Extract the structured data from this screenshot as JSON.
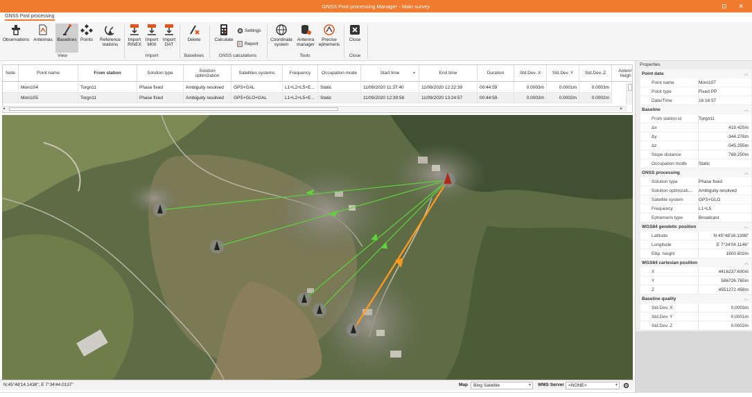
{
  "window": {
    "title": "GNSS Post processing Manager - Main survey",
    "controls": [
      "⊡",
      "✕"
    ]
  },
  "ribbon_tab": "GNSS Post processing",
  "ribbon": {
    "view": {
      "label": "View",
      "buttons": {
        "observations": "Observations",
        "antennas": "Antennas",
        "baselines": "Baselines",
        "points": "Points",
        "reference_l1": "Reference",
        "reference_l2": "stations"
      }
    },
    "import": {
      "label": "Import",
      "buttons": {
        "rinex_l1": "Import",
        "rinex_l2": "RINEX",
        "m00_l1": "Import",
        "m00_l2": "M00",
        "dat_l1": "Import",
        "dat_l2": "DAT"
      }
    },
    "baselines": {
      "label": "Baselines",
      "delete": "Delete"
    },
    "gnss_calc": {
      "label": "GNSS calculations",
      "calculate": "Calculate",
      "settings": "Settings",
      "report": "Report"
    },
    "tools": {
      "label": "Tools",
      "coord_l1": "Coordinate",
      "coord_l2": "system",
      "antenna_l1": "Antenna",
      "antenna_l2": "manager",
      "precise_l1": "Precise",
      "precise_l2": "ephemeris"
    },
    "close": {
      "label": "Close",
      "button": "Close"
    }
  },
  "grid": {
    "headers": {
      "note": "Note",
      "point_name": "Point name",
      "from_station": "From station",
      "solution_type": "Solution type",
      "solution_opt_l1": "Solution",
      "solution_opt_l2": "optimization",
      "satellites": "Satellites systems",
      "frequency": "Frequency",
      "occupation": "Occupation mode",
      "start_time": "Start time",
      "end_time": "End time",
      "duration": "Duration",
      "sdx": "Std.Dev. X",
      "sdy": "Std.Dev. Y",
      "sdz": "Std.Dev. Z",
      "antenna_l1": "Antenn",
      "antenna_l2": "heigh"
    },
    "rows": [
      {
        "point_name": "Moni104",
        "from_station": "Torgn11",
        "solution_type": "Phase fixed",
        "solution_opt": "Ambiguity resolved",
        "satellites": "GPS+GAL",
        "frequency": "L1+L2+L5+E...",
        "occupation": "Static",
        "start_time": "11/09/2020 11:37:40",
        "end_time": "11/09/2020 12:22:39",
        "duration": "00:44:59",
        "sdx": "0.0003m",
        "sdy": "0.0001m",
        "sdz": "0.0003m"
      },
      {
        "point_name": "Moni105",
        "from_station": "Torgn11",
        "solution_type": "Phase fixed",
        "solution_opt": "Ambiguity resolved",
        "satellites": "GPS+GLO+GAL",
        "frequency": "L1+L2+L5+E...",
        "occupation": "Static",
        "start_time": "11/09/2020 12:39:58",
        "end_time": "11/09/2020 13:24:57",
        "duration": "00:44:59",
        "sdx": "0.0003m",
        "sdy": "0.0002m",
        "sdz": "0.0002m"
      }
    ]
  },
  "map": {
    "coords": "N:45°48'14.1438\"; E 7°34'44.0137\"",
    "map_label": "Map",
    "map_value": "Bing Satellite",
    "wms_label": "WMS Server",
    "wms_value": "<NONE>",
    "baseline_colors": {
      "normal": "#5fd43a",
      "selected": "#ff9a1f"
    }
  },
  "properties": {
    "title": "Properties",
    "point_data": {
      "label": "Point data",
      "name_k": "Point name",
      "name_v": "Moni107",
      "type_k": "Point type",
      "type_v": "Fixed PP",
      "dt_k": "Date/Time",
      "dt_v": "16:16:57"
    },
    "baseline": {
      "label": "Baseline",
      "from_k": "From station id",
      "from_v": "Torgn11",
      "dx_k": "Δx",
      "dx_v": "419.425m",
      "dy_k": "Δy",
      "dy_v": "-344.276m",
      "dz_k": "Δz",
      "dz_v": "-545.255m",
      "slope_k": "Slope distance",
      "slope_v": "769.250m",
      "occ_k": "Occupation mode",
      "occ_v": "Static"
    },
    "processing": {
      "label": "GNSS processing",
      "sol_k": "Solution type",
      "sol_v": "Phase fixed",
      "opt_k": "Solution optimizati...",
      "opt_v": "Ambiguity resolved",
      "sat_k": "Satellite system",
      "sat_v": "GPS+GLO",
      "freq_k": "Frequency",
      "freq_v": "L1+L5",
      "eph_k": "Ephemeris type",
      "eph_v": "Broadcast"
    },
    "geodetic": {
      "label": "WGS84 geodetic position",
      "lat_k": "Latitude",
      "lat_v": "N 45°48'16.1398\"",
      "lon_k": "Longitude",
      "lon_v": "E 7°34'04.1146\"",
      "h_k": "Ellip. height",
      "h_v": "1600.602m"
    },
    "cartesian": {
      "label": "WGS84 cartesian position",
      "x_k": "X",
      "x_v": "4416237.690m",
      "y_k": "Y",
      "y_v": "586726.765m",
      "z_k": "Z",
      "z_v": "4551272.458m"
    },
    "quality": {
      "label": "Baseline quality",
      "sdx_k": "Std.Dev. X",
      "sdx_v": "0.0003m",
      "sdy_k": "Std.Dev. Y",
      "sdy_v": "0.0001m",
      "sdz_k": "Std.Dev. Z",
      "sdz_v": "0.0002m"
    }
  }
}
